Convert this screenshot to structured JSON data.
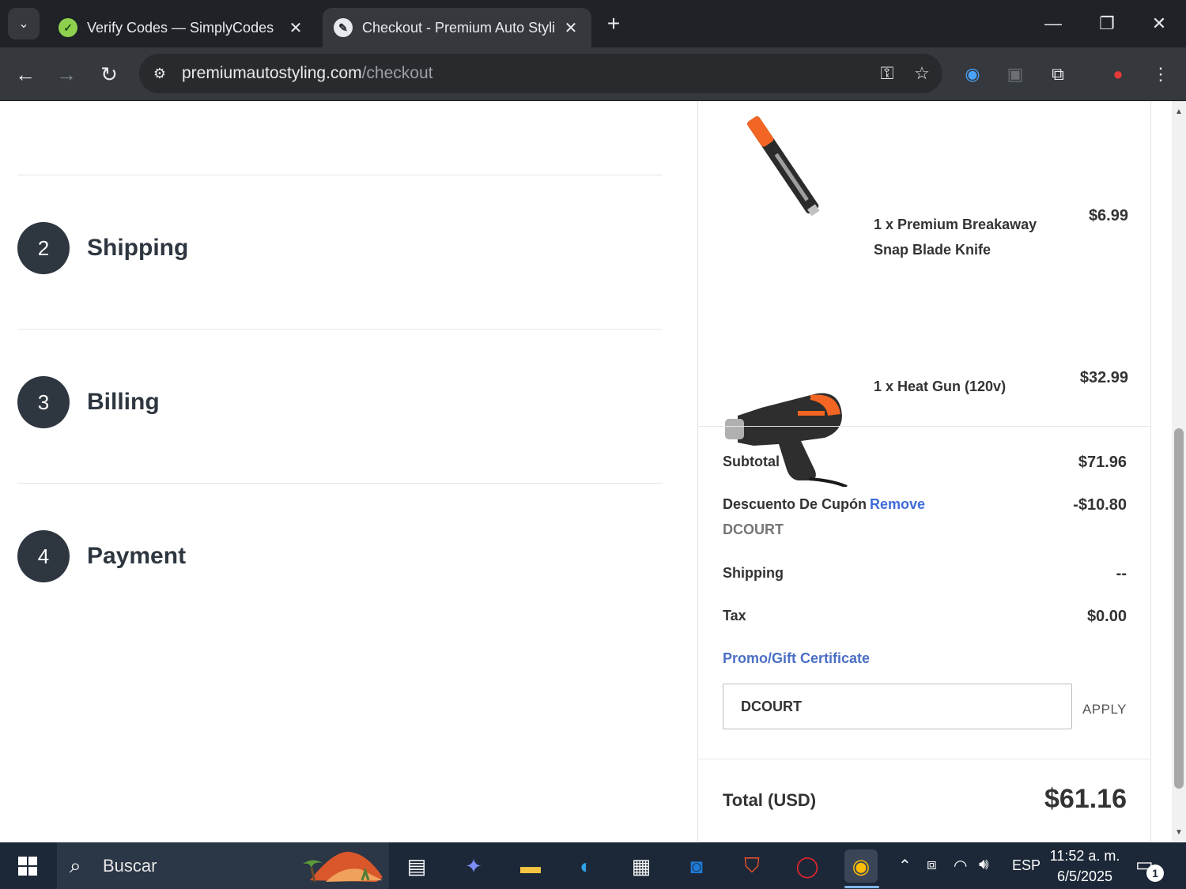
{
  "browser": {
    "tabs": [
      {
        "title": "Verify Codes — SimplyCodes",
        "favicon": "simplycodes-icon"
      },
      {
        "title": "Checkout - Premium Auto Stylir",
        "favicon": "feather-icon"
      }
    ],
    "url_host": "premiumautostyling.com",
    "url_path": "/checkout"
  },
  "steps": [
    {
      "number": "2",
      "title": "Shipping"
    },
    {
      "number": "3",
      "title": "Billing"
    },
    {
      "number": "4",
      "title": "Payment"
    }
  ],
  "order": {
    "items": [
      {
        "name": "1 x Premium Breakaway Snap Blade Knife",
        "price": "$6.99"
      },
      {
        "name": "1 x Heat Gun (120v)",
        "price": "$32.99"
      }
    ],
    "subtotal_label": "Subtotal",
    "subtotal": "$71.96",
    "discount_label": "Descuento De Cupón",
    "remove_label": "Remove",
    "discount": "-$10.80",
    "coupon_code": "DCOURT",
    "shipping_label": "Shipping",
    "shipping": "--",
    "tax_label": "Tax",
    "tax": "$0.00",
    "promo_label": "Promo/Gift Certificate",
    "promo_value": "DCOURT",
    "apply_label": "APPLY",
    "total_label": "Total (USD)",
    "total": "$61.16"
  },
  "taskbar": {
    "search_placeholder": "Buscar",
    "language": "ESP",
    "time": "11:52 a. m.",
    "date": "6/5/2025",
    "notification_count": "1"
  },
  "colors": {
    "link": "#3f6cd8",
    "step_circle": "#2e3640",
    "taskbar": "#1c2838",
    "browser_dark": "#1f2226"
  }
}
